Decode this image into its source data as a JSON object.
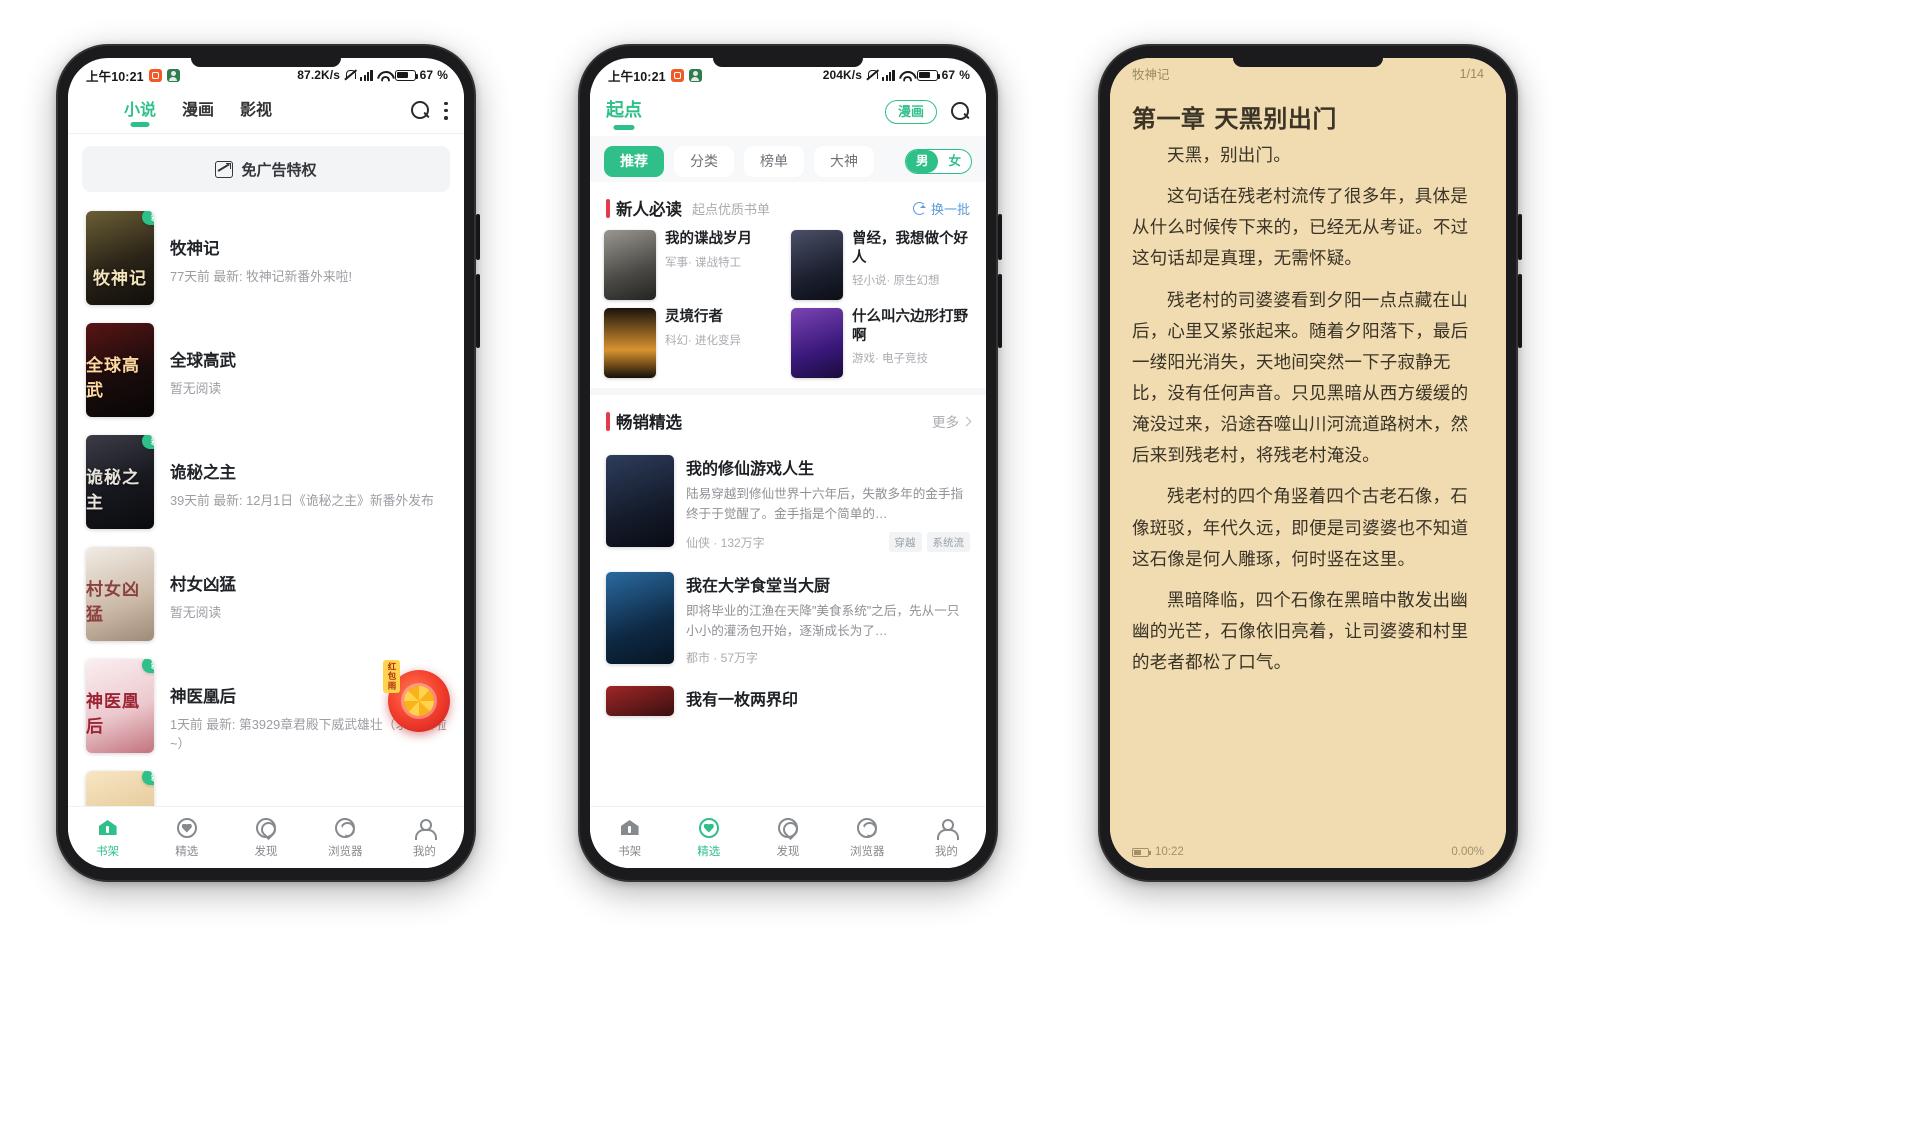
{
  "status_bar": {
    "time": "上午10:21",
    "net_speed_1": "87.2K/s",
    "net_speed_2": "204K/s",
    "battery": "67",
    "battery_unit": "%"
  },
  "phone1": {
    "tabs": [
      {
        "label": "小说",
        "active": true
      },
      {
        "label": "漫画",
        "active": false
      },
      {
        "label": "影视",
        "active": false
      }
    ],
    "search_icon": "search-icon",
    "menu_icon": "more-vertical-icon",
    "ad_banner": "免广告特权",
    "new_badge": "新",
    "books": [
      {
        "title": "牧神记",
        "sub": "77天前 最新: 牧神记新番外来啦!",
        "new": true,
        "cover_text": "牧神记",
        "c1": "#4a4226",
        "c2": "#1a1711"
      },
      {
        "title": "全球高武",
        "sub": "暂无阅读",
        "new": false,
        "cover_text": "全球高武",
        "c1": "#3a1010",
        "c2": "#0d0808"
      },
      {
        "title": "诡秘之主",
        "sub": "39天前 最新: 12月1日《诡秘之主》新番外发布",
        "new": true,
        "cover_text": "诡秘之主",
        "c1": "#2a2b34",
        "c2": "#0f1014"
      },
      {
        "title": "村女凶猛",
        "sub": "暂无阅读",
        "new": false,
        "cover_text": "村女凶猛",
        "c1": "#e8dfd6",
        "c2": "#bba893"
      },
      {
        "title": "神医凰后",
        "sub": "1天前 最新: 第3929章君殿下威武雄壮（求月票啦~）",
        "new": true,
        "cover_text": "神医凰后",
        "c1": "#f3e2e5",
        "c2": "#c97f86"
      }
    ],
    "gift_tag": "红包雨",
    "tabbar": [
      {
        "label": "书架",
        "icon": "home-icon",
        "active": true
      },
      {
        "label": "精选",
        "icon": "heart-circle-icon",
        "active": false
      },
      {
        "label": "发现",
        "icon": "compass-icon",
        "active": false
      },
      {
        "label": "浏览器",
        "icon": "browser-icon",
        "active": false
      },
      {
        "label": "我的",
        "icon": "person-icon",
        "active": false
      }
    ]
  },
  "phone2": {
    "brand": "起点",
    "comic_pill": "漫画",
    "search_icon": "search-icon",
    "chips": [
      {
        "label": "推荐",
        "active": true
      },
      {
        "label": "分类",
        "active": false
      },
      {
        "label": "榜单",
        "active": false
      },
      {
        "label": "大神",
        "active": false
      }
    ],
    "gender": {
      "male": "男",
      "female": "女",
      "selected": "男"
    },
    "section1": {
      "title": "新人必读",
      "subtitle": "起点优质书单",
      "action": "换一批",
      "action_icon": "refresh-icon",
      "items": [
        {
          "title": "我的谍战岁月",
          "sub": "军事· 谍战特工",
          "c1": "#8c8b86",
          "c2": "#3a3a38"
        },
        {
          "title": "曾经，我想做个好人",
          "sub": "轻小说· 原生幻想",
          "c1": "#3b3f52",
          "c2": "#14161f"
        },
        {
          "title": "灵境行者",
          "sub": "科幻· 进化变异",
          "c1": "#d89a3a",
          "c2": "#120d08"
        },
        {
          "title": "什么叫六边形打野啊",
          "sub": "游戏· 电子竞技",
          "c1": "#6d3fa0",
          "c2": "#2a1450"
        }
      ]
    },
    "section2": {
      "title": "畅销精选",
      "action": "更多",
      "action_icon": "chevron-right-icon",
      "items": [
        {
          "title": "我的修仙游戏人生",
          "desc": "陆易穿越到修仙世界十六年后，失散多年的金手指终于于觉醒了。金手指是个简单的…",
          "cat": "仙侠 · 132万字",
          "tags": [
            "穿越",
            "系统流"
          ],
          "c1": "#24304a",
          "c2": "#0c1018"
        },
        {
          "title": "我在大学食堂当大厨",
          "desc": "即将毕业的江渔在天降\"美食系统\"之后，先从一只小小的灌汤包开始，逐渐成长为了…",
          "cat": "都市 · 57万字",
          "tags": [],
          "c1": "#1e4e7a",
          "c2": "#0a1d30"
        },
        {
          "title": "我有一枚两界印",
          "desc": "",
          "cat": "",
          "tags": [],
          "c1": "#7a2020",
          "c2": "#2b0c0c"
        }
      ]
    },
    "tabbar": [
      {
        "label": "书架",
        "icon": "home-icon",
        "active": false
      },
      {
        "label": "精选",
        "icon": "heart-circle-icon",
        "active": true
      },
      {
        "label": "发现",
        "icon": "compass-icon",
        "active": false
      },
      {
        "label": "浏览器",
        "icon": "browser-icon",
        "active": false
      },
      {
        "label": "我的",
        "icon": "person-icon",
        "active": false
      }
    ]
  },
  "phone3": {
    "book_name": "牧神记",
    "page_indicator": "1/14",
    "chapter_title": "第一章 天黑别出门",
    "paragraphs": [
      "天黑，别出门。",
      "这句话在残老村流传了很多年，具体是从什么时候传下来的，已经无从考证。不过这句话却是真理，无需怀疑。",
      "残老村的司婆婆看到夕阳一点点藏在山后，心里又紧张起来。随着夕阳落下，最后一缕阳光消失，天地间突然一下子寂静无比，没有任何声音。只见黑暗从西方缓缓的淹没过来，沿途吞噬山川河流道路树木，然后来到残老村，将残老村淹没。",
      "残老村的四个角竖着四个古老石像，石像斑驳，年代久远，即便是司婆婆也不知道这石像是何人雕琢，何时竖在这里。",
      "黑暗降临，四个石像在黑暗中散发出幽幽的光芒，石像依旧亮着，让司婆婆和村里的老者都松了口气。"
    ],
    "clock": "10:22",
    "progress": "0.00%"
  }
}
